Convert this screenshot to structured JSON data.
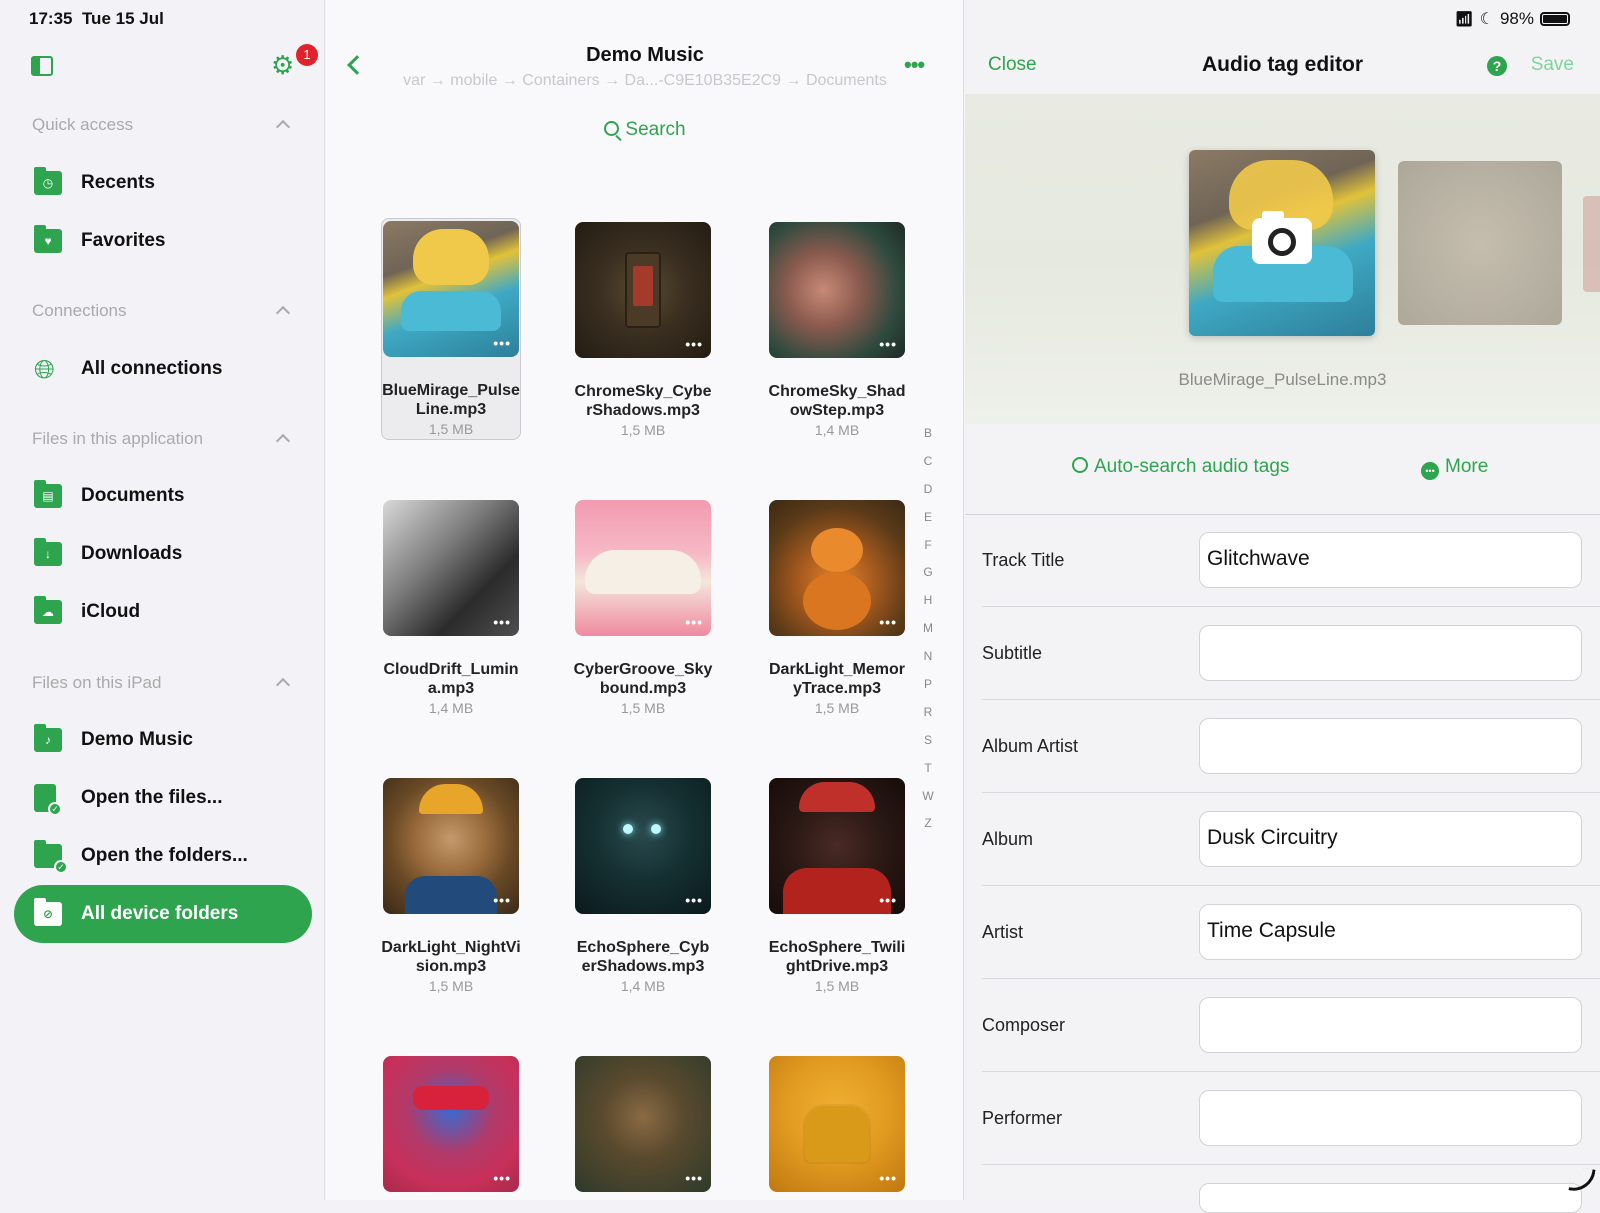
{
  "status": {
    "time": "17:35",
    "date": "Tue 15 Jul",
    "battery": "98%",
    "battery_level": 0.98
  },
  "sidebar": {
    "badge": "1",
    "sections": [
      {
        "title": "Quick access",
        "items": [
          {
            "label": "Recents",
            "icon": "clock-folder-icon"
          },
          {
            "label": "Favorites",
            "icon": "heart-folder-icon"
          }
        ]
      },
      {
        "title": "Connections",
        "items": [
          {
            "label": "All connections",
            "icon": "globe-icon"
          }
        ]
      },
      {
        "title": "Files in this application",
        "items": [
          {
            "label": "Documents",
            "icon": "document-folder-icon"
          },
          {
            "label": "Downloads",
            "icon": "download-folder-icon"
          },
          {
            "label": "iCloud",
            "icon": "cloud-folder-icon"
          }
        ]
      },
      {
        "title": "Files on this iPad",
        "items": [
          {
            "label": "Demo Music",
            "icon": "music-folder-icon"
          },
          {
            "label": "Open the files...",
            "icon": "file-check-icon"
          },
          {
            "label": "Open the folders...",
            "icon": "folder-check-icon"
          },
          {
            "label": "All device folders",
            "icon": "device-folder-icon",
            "active": true
          }
        ]
      }
    ]
  },
  "browser": {
    "title": "Demo Music",
    "breadcrumb": "var → mobile → Containers → Da...-C9E10B35E2C9 → Documents",
    "search_label": "Search",
    "alphabet": [
      "B",
      "C",
      "D",
      "E",
      "F",
      "G",
      "H",
      "M",
      "N",
      "P",
      "R",
      "S",
      "T",
      "W",
      "Z"
    ],
    "files": [
      {
        "name": "BlueMirage_PulseLine.mp3",
        "size": "1,5 MB",
        "selected": true
      },
      {
        "name": "ChromeSky_CyberShadows.mp3",
        "size": "1,5 MB"
      },
      {
        "name": "ChromeSky_ShadowStep.mp3",
        "size": "1,4 MB"
      },
      {
        "name": "CloudDrift_Lumina.mp3",
        "size": "1,4 MB"
      },
      {
        "name": "CyberGroove_Skybound.mp3",
        "size": "1,5 MB"
      },
      {
        "name": "DarkLight_MemoryTrace.mp3",
        "size": "1,5 MB"
      },
      {
        "name": "DarkLight_NightVision.mp3",
        "size": "1,5 MB"
      },
      {
        "name": "EchoSphere_CyberShadows.mp3",
        "size": "1,4 MB"
      },
      {
        "name": "EchoSphere_TwilightDrive.mp3",
        "size": "1,5 MB"
      },
      {
        "name": "",
        "size": ""
      },
      {
        "name": "",
        "size": ""
      },
      {
        "name": "",
        "size": ""
      }
    ]
  },
  "editor": {
    "close_label": "Close",
    "title": "Audio tag editor",
    "save_label": "Save",
    "file_name": "BlueMirage_PulseLine.mp3",
    "auto_search_label": "Auto-search audio tags",
    "more_label": "More",
    "fields": [
      {
        "label": "Track Title",
        "value": "Glitchwave"
      },
      {
        "label": "Subtitle",
        "value": ""
      },
      {
        "label": "Album Artist",
        "value": ""
      },
      {
        "label": "Album",
        "value": "Dusk Circuitry"
      },
      {
        "label": "Artist",
        "value": "Time Capsule"
      },
      {
        "label": "Composer",
        "value": ""
      },
      {
        "label": "Performer",
        "value": ""
      }
    ]
  },
  "colors": {
    "accent": "#2ea44f",
    "save_disabled": "#7fd49a",
    "badge": "#e0222c"
  }
}
